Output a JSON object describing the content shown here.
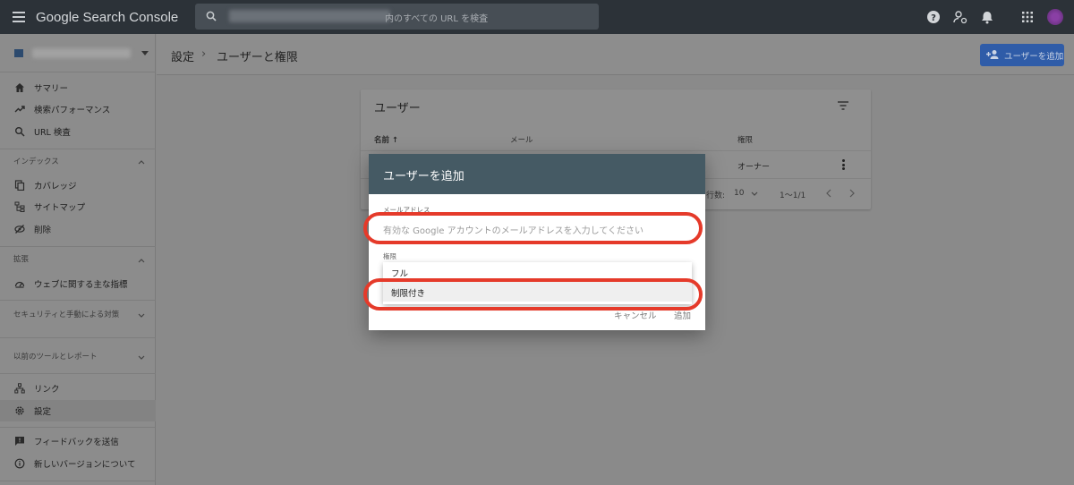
{
  "topbar": {
    "app_title": "Google Search Console",
    "search_suffix": "内のすべての URL を検査"
  },
  "header": {
    "breadcrumb_settings": "設定",
    "breadcrumb_sep": "›",
    "breadcrumb_page": "ユーザーと権限",
    "add_user_label": "ユーザーを追加"
  },
  "sidebar": {
    "items_main": [
      {
        "label": "サマリー",
        "icon": "home-icon"
      },
      {
        "label": "検索パフォーマンス",
        "icon": "trending-up-icon"
      },
      {
        "label": "URL 検査",
        "icon": "search-icon"
      }
    ],
    "section_index": "インデックス",
    "items_index": [
      {
        "label": "カバレッジ",
        "icon": "coverage-icon"
      },
      {
        "label": "サイトマップ",
        "icon": "sitemap-icon"
      },
      {
        "label": "削除",
        "icon": "removal-icon"
      }
    ],
    "section_enhance": "拡張",
    "items_enhance": [
      {
        "label": "ウェブに関する主な指標",
        "icon": "speed-icon"
      }
    ],
    "section_security": "セキュリティと手動による対策",
    "section_legacy": "以前のツールとレポート",
    "items_bottom": [
      {
        "label": "リンク",
        "icon": "links-icon"
      },
      {
        "label": "設定",
        "icon": "gear-icon"
      }
    ],
    "items_footer": [
      {
        "label": "フィードバックを送信",
        "icon": "feedback-icon"
      },
      {
        "label": "新しいバージョンについて",
        "icon": "info-icon"
      }
    ]
  },
  "users_card": {
    "title": "ユーザー",
    "columns": {
      "name": "名前 ↑",
      "email": "メール",
      "permission": "権限"
    },
    "rows": [
      {
        "permission": "オーナー"
      }
    ],
    "pager": {
      "rows_label": "行数:",
      "rows_value": "10",
      "range": "1〜1/1"
    }
  },
  "dialog": {
    "title": "ユーザーを追加",
    "email_label": "メールアドレス",
    "email_placeholder": "有効な Google アカウントのメールアドレスを入力してください",
    "permission_label": "権限",
    "options": [
      "フル",
      "制限付き"
    ],
    "selected_option": "制限付き",
    "cancel": "キャンセル",
    "add": "追加"
  },
  "colors": {
    "topbar": "#2c3238",
    "dialog_header": "#455a64",
    "highlight": "#e53a2a",
    "primary_button": "#2f5ca8"
  }
}
